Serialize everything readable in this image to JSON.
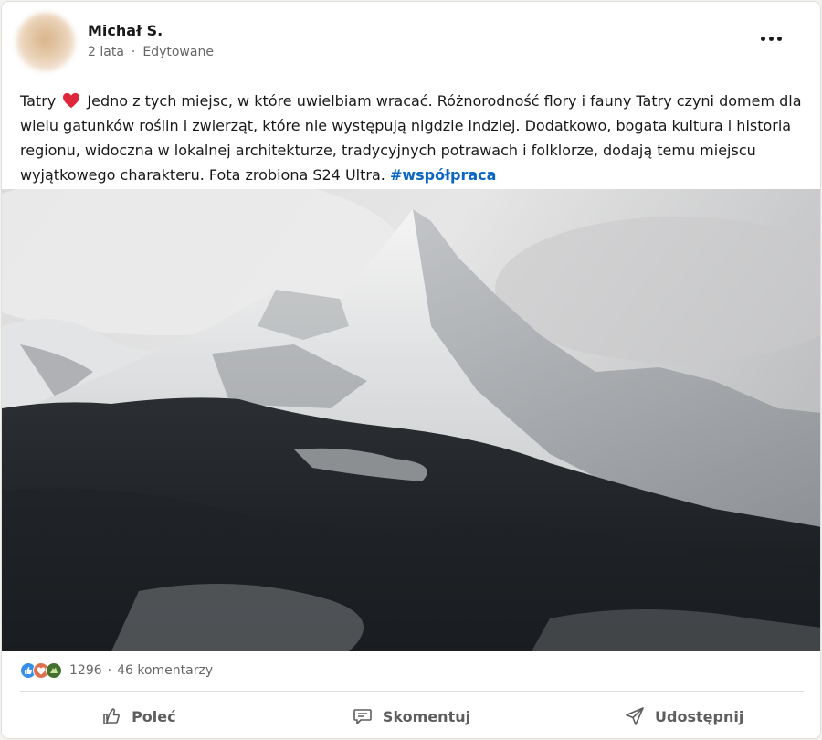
{
  "post": {
    "author": "Michał S.",
    "time": "2 lata",
    "separator": "·",
    "edited": "Edytowane",
    "text_before_heart": "Tatry ",
    "text_main": " Jedno z tych miejsc, w które uwielbiam wracać. Różnorodność flory i fauny Tatry czyni domem dla wielu gatunków roślin i zwierząt, które nie występują nigdzie indziej. Dodatkowo, bogata kultura i historia regionu, widoczna w lokalnej architekturze, tradycyjnych potrawach i folklorze, dodają temu miejscu wyjątkowego charakteru. Fota zrobiona S24 Ultra. ",
    "hashtag": "#współpraca"
  },
  "social": {
    "reaction_count": "1296",
    "separator": "·",
    "comments": "46 komentarzy"
  },
  "actions": {
    "like": "Poleć",
    "comment": "Skomentuj",
    "share": "Udostępnij"
  },
  "colors": {
    "accent": "#0a66c2",
    "heart": "#e0263a",
    "like_reaction": "#378fe9",
    "love_reaction": "#df704d",
    "support_reaction": "#44712e"
  },
  "icons": [
    "more-options-icon",
    "heart-emoji-icon",
    "like-reaction-icon",
    "love-reaction-icon",
    "support-reaction-icon",
    "like-icon",
    "comment-icon",
    "share-icon"
  ]
}
